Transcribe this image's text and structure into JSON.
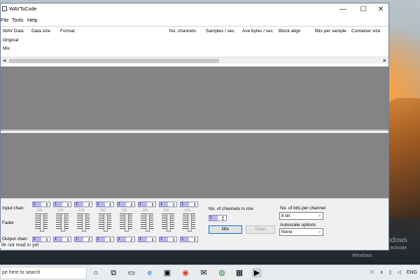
{
  "window": {
    "title": "WAVToCode",
    "controls": {
      "minimize": "—",
      "maximize": "☐",
      "close": "✕"
    }
  },
  "menu": [
    "File",
    "Tools",
    "Help"
  ],
  "grid": {
    "columns": [
      "WAV Data",
      "Data size",
      "Format",
      "No. channels",
      "Samples / sec",
      "Ave bytes / sec",
      "Block align",
      "Bits per sample",
      "Container size"
    ],
    "rows": [
      "Original",
      "Mix"
    ]
  },
  "controls": {
    "input_label": "Input chan:",
    "fader_label": "Fader",
    "output_label": "Output chan:",
    "channel_count": 8,
    "channel_value": "1",
    "fader_percent": "100",
    "mix_channels_label": "No. of channels in mix",
    "mix_channels_value": "1",
    "mix_button": "Mix",
    "clear_button": "Clear",
    "bits_label": "No. of bits per channel",
    "bits_value": "8 bit",
    "autoscale_label": "Autoscale options",
    "autoscale_value": "None"
  },
  "status": "ile not read in yet",
  "desktop": {
    "watermark_title": "Activate Windows",
    "watermark_sub": "Go to Settings to activate Windows."
  },
  "taskbar": {
    "search_placeholder": "ре here to search",
    "tray": {
      "language": "ENG",
      "chevron": "∧"
    }
  },
  "colors": {
    "window_bg": "#f0f0f0",
    "wave_bg": "#848484",
    "spin_highlight": "#b9b5f0",
    "mix_border": "#0b6fd0",
    "taskbar_bg": "#e9ecef"
  }
}
